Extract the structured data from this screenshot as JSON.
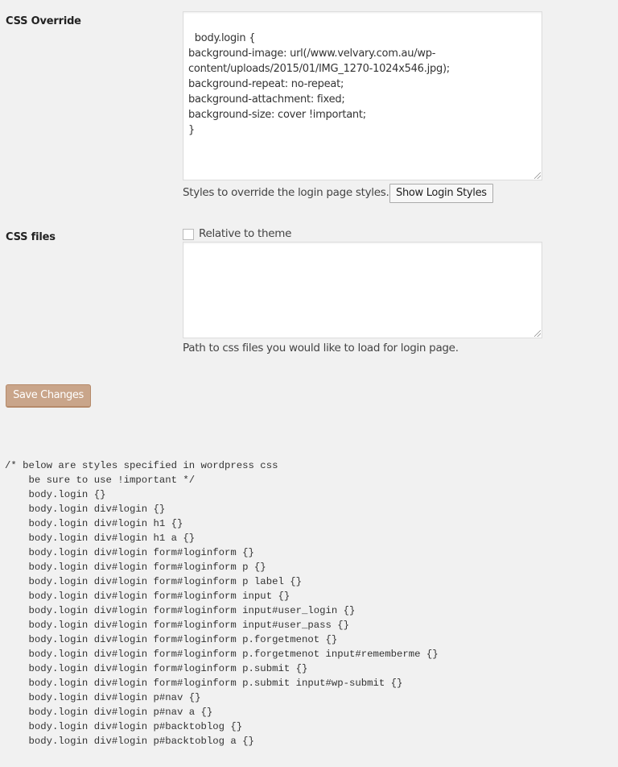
{
  "css_override": {
    "label": "CSS Override",
    "value": "body.login {\nbackground-image: url(/www.velvary.com.au/wp-\ncontent/uploads/2015/01/IMG_1270-1024x546.jpg);\nbackground-repeat: no-repeat;\nbackground-attachment: fixed;\nbackground-size: cover !important;\n}",
    "description": "Styles to override the login page styles.",
    "show_button_label": "Show Login Styles"
  },
  "css_files": {
    "label": "CSS files",
    "checkbox_label": "Relative to theme",
    "checkbox_checked": false,
    "value": "",
    "description": "Path to css files you would like to load for login page."
  },
  "save_button_label": "Save Changes",
  "login_styles_reference": "/* below are styles specified in wordpress css\n    be sure to use !important */\n    body.login {}\n    body.login div#login {}\n    body.login div#login h1 {}\n    body.login div#login h1 a {}\n    body.login div#login form#loginform {}\n    body.login div#login form#loginform p {}\n    body.login div#login form#loginform p label {}\n    body.login div#login form#loginform input {}\n    body.login div#login form#loginform input#user_login {}\n    body.login div#login form#loginform input#user_pass {}\n    body.login div#login form#loginform p.forgetmenot {}\n    body.login div#login form#loginform p.forgetmenot input#rememberme {}\n    body.login div#login form#loginform p.submit {}\n    body.login div#login form#loginform p.submit input#wp-submit {}\n    body.login div#login p#nav {}\n    body.login div#login p#nav a {}\n    body.login div#login p#backtoblog {}\n    body.login div#login p#backtoblog a {}",
  "colors": {
    "background": "#f1f1f1",
    "primary_button": "#c9a58a"
  }
}
